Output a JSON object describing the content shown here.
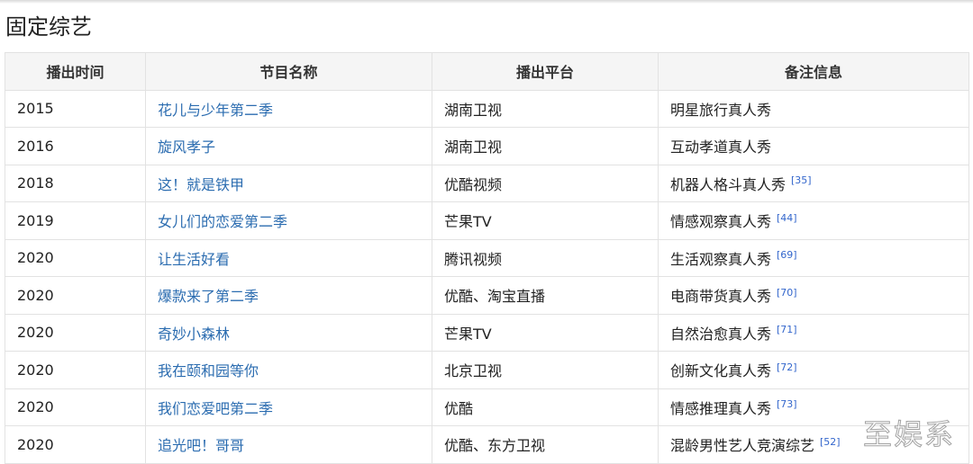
{
  "title": "固定综艺",
  "headers": [
    "播出时间",
    "节目名称",
    "播出平台",
    "备注信息"
  ],
  "rows": [
    {
      "year": "2015",
      "name": "花儿与少年第二季",
      "platform": "湖南卫视",
      "note": "明星旅行真人秀",
      "ref": ""
    },
    {
      "year": "2016",
      "name": "旋风孝子",
      "platform": "湖南卫视",
      "note": "互动孝道真人秀",
      "ref": ""
    },
    {
      "year": "2018",
      "name": "这！就是铁甲",
      "platform": "优酷视频",
      "note": "机器人格斗真人秀",
      "ref": "[35]"
    },
    {
      "year": "2019",
      "name": "女儿们的恋爱第二季",
      "platform": "芒果TV",
      "note": "情感观察真人秀",
      "ref": "[44]"
    },
    {
      "year": "2020",
      "name": "让生活好看",
      "platform": "腾讯视频",
      "note": "生活观察真人秀",
      "ref": "[69]"
    },
    {
      "year": "2020",
      "name": "爆款来了第二季",
      "platform": "优酷、淘宝直播",
      "note": "电商带货真人秀",
      "ref": "[70]"
    },
    {
      "year": "2020",
      "name": "奇妙小森林",
      "platform": "芒果TV",
      "note": "自然治愈真人秀",
      "ref": "[71]"
    },
    {
      "year": "2020",
      "name": "我在颐和园等你",
      "platform": "北京卫视",
      "note": "创新文化真人秀",
      "ref": "[72]"
    },
    {
      "year": "2020",
      "name": "我们恋爱吧第二季",
      "platform": "优酷",
      "note": "情感推理真人秀",
      "ref": "[73]"
    },
    {
      "year": "2020",
      "name": "追光吧！哥哥",
      "platform": "优酷、东方卫视",
      "note": "混龄男性艺人竞演综艺",
      "ref": "[52]"
    }
  ],
  "watermark": "至娱系"
}
